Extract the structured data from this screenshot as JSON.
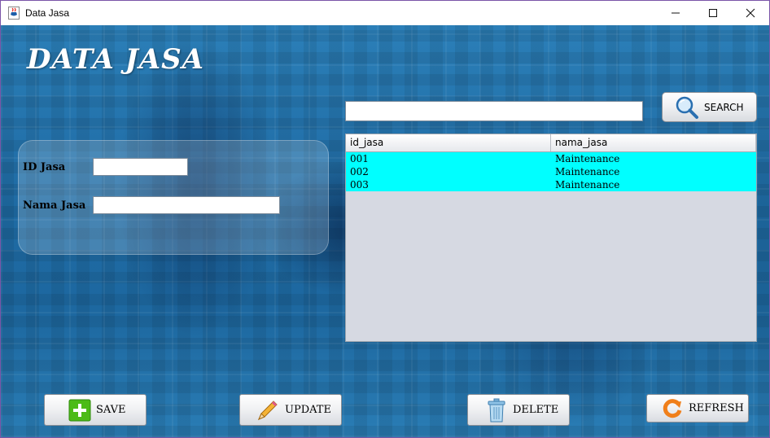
{
  "window": {
    "title": "Data Jasa",
    "controls": {
      "minimize": "minimize",
      "maximize": "maximize",
      "close": "close"
    }
  },
  "header": {
    "title": "DATA JASA"
  },
  "form": {
    "id_label": "ID Jasa",
    "id_value": "",
    "name_label": "Nama Jasa",
    "name_value": ""
  },
  "search": {
    "value": "",
    "button_label": "SEARCH"
  },
  "table": {
    "columns": [
      "id_jasa",
      "nama_jasa"
    ],
    "rows": [
      [
        "001",
        "Maintenance"
      ],
      [
        "002",
        "Maintenance"
      ],
      [
        "003",
        "Maintenance"
      ]
    ]
  },
  "actions": {
    "save": "SAVE",
    "update": "UPDATE",
    "delete": "DELETE",
    "refresh": "REFRESH"
  },
  "colors": {
    "row_highlight": "#00ffff",
    "window_border": "#7a55a8",
    "table_background": "#d6d9e2"
  },
  "icons": {
    "app": "java-coffee-icon",
    "search": "magnifier-icon",
    "save": "green-plus-icon",
    "update": "pencil-icon",
    "delete": "trash-can-icon",
    "refresh": "orange-refresh-icon"
  }
}
